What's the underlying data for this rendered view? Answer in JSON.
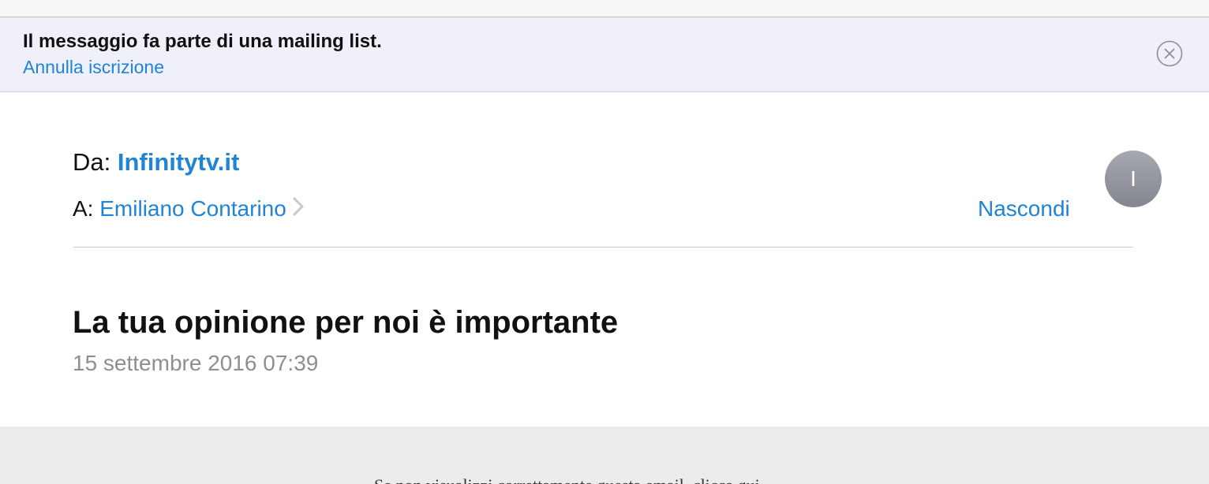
{
  "banner": {
    "title": "Il messaggio fa parte di una mailing list.",
    "unsubscribe_label": "Annulla iscrizione",
    "close_icon": "close-circle-icon"
  },
  "header": {
    "from_label": "Da:",
    "from_name": "Infinitytv.it",
    "to_label": "A:",
    "to_name": "Emiliano Contarino",
    "hide_label": "Nascondi",
    "avatar_initial": "I"
  },
  "message": {
    "subject": "La tua opinione per noi è importante",
    "date": "15 settembre 2016 07:39"
  },
  "body": {
    "preview_text": "Se non visualizzi correttamente questa email, clicca qui"
  },
  "colors": {
    "accent": "#1f83d6",
    "banner_bg": "#eff0fa",
    "secondary_text": "#8e8e93"
  }
}
